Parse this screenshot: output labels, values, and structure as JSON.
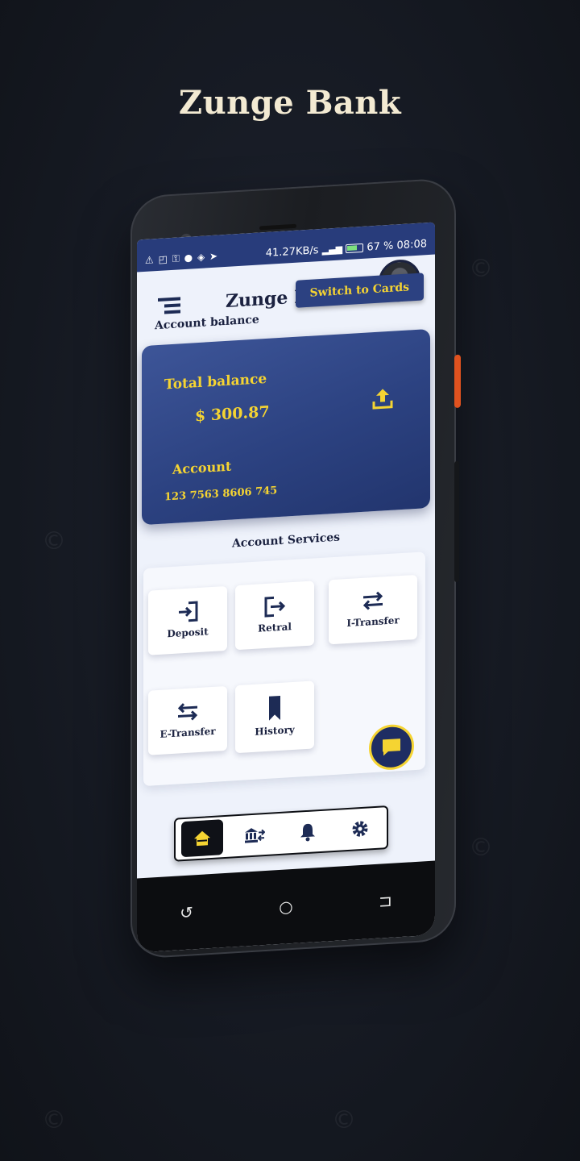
{
  "headline": "Zunge Bank",
  "statusbar": {
    "left_icons": "⚠ ◰ ⚿ ● ◈ ➤",
    "net_speed": "41.27KB/s",
    "signal": "📶",
    "battery": "67 %",
    "time": "08:08"
  },
  "app": {
    "title": "Zunge Bank",
    "switch_button": "Switch to Cards",
    "account_balance_label": "Account balance"
  },
  "card": {
    "total_label": "Total balance",
    "amount": "$ 300.87",
    "account_label": "Account",
    "account_number": "123 7563 8606 745"
  },
  "services": {
    "title": "Account Services",
    "items": [
      {
        "label": "Deposit",
        "icon": "login-icon"
      },
      {
        "label": "Retral",
        "icon": "logout-icon"
      },
      {
        "label": "I-Transfer",
        "icon": "transfer-icon"
      },
      {
        "label": "E-Transfer",
        "icon": "transfer-icon"
      },
      {
        "label": "History",
        "icon": "bookmark-icon"
      }
    ]
  },
  "bottomnav": {
    "items": [
      "home-icon",
      "bank-transfer-icon",
      "bell-icon",
      "gear-icon"
    ],
    "active": "home-icon"
  },
  "sysnav": {
    "back": "↺",
    "home": "○",
    "recent": "⊐"
  },
  "colors": {
    "accent": "#f5d432",
    "brand": "#2c4181",
    "dark": "#1b2240",
    "background": "#eef2fb"
  }
}
